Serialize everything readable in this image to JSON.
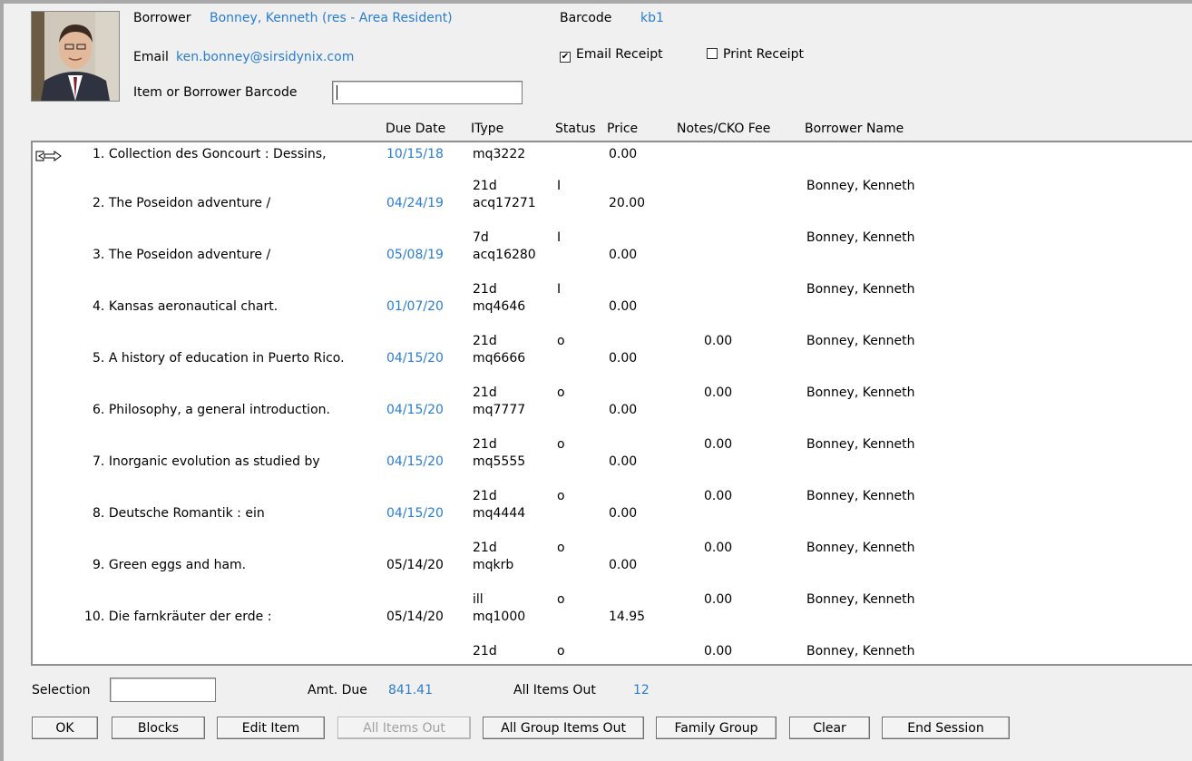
{
  "borrower": {
    "borrower_label": "Borrower",
    "borrower_value": "Bonney, Kenneth (res - Area Resident)",
    "barcode_label": "Barcode",
    "barcode_value": "kb1",
    "email_label": "Email",
    "email_value": "ken.bonney@sirsidynix.com",
    "email_receipt_label": "Email Receipt",
    "email_receipt_checked": true,
    "print_receipt_label": "Print Receipt",
    "print_receipt_checked": false,
    "barcode_input_label": "Item or Borrower Barcode",
    "barcode_input_value": ""
  },
  "table": {
    "headers": {
      "due_date": "Due Date",
      "itype": "IType",
      "status": "Status",
      "price": "Price",
      "notes": "Notes/CKO Fee",
      "borrower_name": "Borrower Name"
    },
    "rows": [
      {
        "num": "1.",
        "title": "Collection des Goncourt : Dessins,",
        "due": "10/15/18",
        "due_blue": true,
        "itype": "",
        "itemid": "mq3222",
        "status": "",
        "price": "0.00",
        "notes": "",
        "borrower": ""
      },
      {
        "num": "2.",
        "title": "The Poseidon adventure /",
        "due": "04/24/19",
        "due_blue": true,
        "itype": "21d",
        "itemid": "acq17271",
        "status": "I",
        "price": "20.00",
        "notes": "",
        "borrower": "Bonney, Kenneth"
      },
      {
        "num": "3.",
        "title": "The Poseidon adventure /",
        "due": "05/08/19",
        "due_blue": true,
        "itype": "7d",
        "itemid": "acq16280",
        "status": "I",
        "price": "0.00",
        "notes": "",
        "borrower": "Bonney, Kenneth"
      },
      {
        "num": "4.",
        "title": "Kansas aeronautical chart.",
        "due": "01/07/20",
        "due_blue": true,
        "itype": "21d",
        "itemid": "mq4646",
        "status": "I",
        "price": "0.00",
        "notes": "",
        "borrower": "Bonney, Kenneth"
      },
      {
        "num": "5.",
        "title": "A history of education in Puerto Rico.",
        "due": "04/15/20",
        "due_blue": true,
        "itype": "21d",
        "itemid": "mq6666",
        "status": "o",
        "price": "0.00",
        "notes": "0.00",
        "borrower": "Bonney, Kenneth"
      },
      {
        "num": "6.",
        "title": "Philosophy, a general introduction.",
        "due": "04/15/20",
        "due_blue": true,
        "itype": "21d",
        "itemid": "mq7777",
        "status": "o",
        "price": "0.00",
        "notes": "0.00",
        "borrower": "Bonney, Kenneth"
      },
      {
        "num": "7.",
        "title": "Inorganic evolution as studied by",
        "due": "04/15/20",
        "due_blue": true,
        "itype": "21d",
        "itemid": "mq5555",
        "status": "o",
        "price": "0.00",
        "notes": "0.00",
        "borrower": "Bonney, Kenneth"
      },
      {
        "num": "8.",
        "title": "Deutsche Romantik : ein",
        "due": "04/15/20",
        "due_blue": true,
        "itype": "21d",
        "itemid": "mq4444",
        "status": "o",
        "price": "0.00",
        "notes": "0.00",
        "borrower": "Bonney, Kenneth"
      },
      {
        "num": "9.",
        "title": "Green eggs and ham.",
        "due": "05/14/20",
        "due_blue": false,
        "itype": "21d",
        "itemid": "mqkrb",
        "status": "o",
        "price": "0.00",
        "notes": "0.00",
        "borrower": "Bonney, Kenneth"
      },
      {
        "num": "10.",
        "title": "Die farnkräuter der erde :",
        "due": "05/14/20",
        "due_blue": false,
        "itype": "ill",
        "itemid": "mq1000",
        "status": "o",
        "price": "14.95",
        "notes": "0.00",
        "borrower": "Bonney, Kenneth"
      },
      {
        "num": "",
        "title": "",
        "due": "",
        "due_blue": false,
        "itype": "21d",
        "itemid": "",
        "status": "o",
        "price": "",
        "notes": "0.00",
        "borrower": "Bonney, Kenneth"
      }
    ]
  },
  "footer": {
    "selection_label": "Selection",
    "selection_value": "",
    "amt_due_label": "Amt. Due",
    "amt_due_value": "841.41",
    "all_items_out_label": "All Items Out",
    "all_items_out_value": "12"
  },
  "buttons": {
    "ok": "OK",
    "blocks": "Blocks",
    "edit_item": "Edit Item",
    "all_items_out": "All Items Out",
    "all_group_items_out": "All Group Items Out",
    "family_group": "Family Group",
    "clear": "Clear",
    "end_session": "End Session"
  },
  "colors": {
    "link_blue": "#2a7dd1",
    "window_bg": "#f0f0f0"
  },
  "icons": {
    "row_pointer": "hand-pointer-icon",
    "photo": "borrower-photo"
  }
}
